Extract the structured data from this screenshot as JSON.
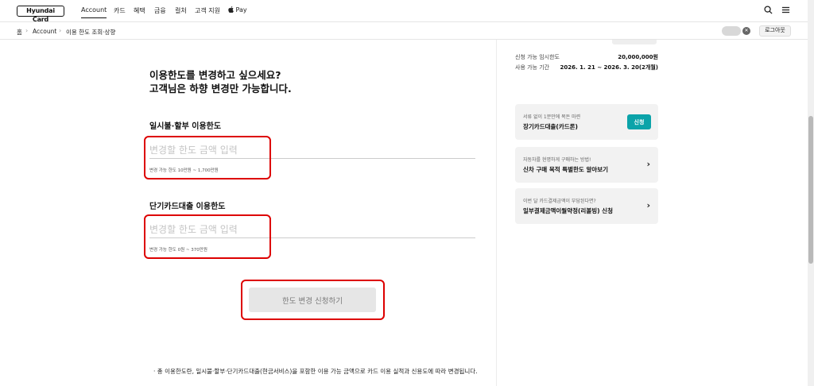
{
  "brand": {
    "logo_text": "Hyundai Card"
  },
  "nav": {
    "items": [
      {
        "label": "Account"
      },
      {
        "label": "카드"
      },
      {
        "label": "혜택"
      },
      {
        "label": "금융"
      },
      {
        "label": "컬처"
      },
      {
        "label": "고객 지원"
      },
      {
        "label": " Pay"
      }
    ],
    "active": "Account"
  },
  "icons": {
    "search": "search-icon",
    "menu": "hamburger-menu-icon",
    "apple": "apple-icon",
    "chevron": "chevron-right-icon"
  },
  "breadcrumb": {
    "home": "홈",
    "level1": "Account",
    "level2": "이용 한도 조회·상향"
  },
  "header_right": {
    "logout_label": "로그아웃"
  },
  "main": {
    "heading_line1": "이용한도를 변경하고 싶으세요?",
    "heading_line2": "고객님은 하향 변경만 가능합니다.",
    "lump_sum": {
      "label": "일시불·할부 이용한도",
      "placeholder": "변경할 한도 금액 입력",
      "hint": "변경 가능 한도 10만원 ~ 1,700만원"
    },
    "short_term_loan": {
      "label": "단기카드대출 이용한도",
      "placeholder": "변경할 한도 금액 입력",
      "hint": "변경 가능 한도 0원 ~ 370만원"
    },
    "submit_label": "한도 변경 신청하기",
    "footnote": "총 이용한도란, 일시불·할부·단기카드대출(현금서비스)을 포함한 이용 가능 금액으로 카드 이용 실적과 신용도에 따라 변경됩니다."
  },
  "side": {
    "rows": [
      {
        "label": "신청 가능 임시한도",
        "value": "20,000,000원"
      },
      {
        "label": "사용 가능 기간",
        "value": "2026. 1. 21 ~ 2026. 3. 20(2개월)"
      }
    ],
    "cards": [
      {
        "sub": "서류 없이 1분만에 목돈 마련",
        "title": "장기카드대출(카드론)",
        "button": "신청"
      },
      {
        "sub": "자동차를 현명하게 구매하는 방법!",
        "title": "신차 구매 목적 특별한도 알아보기"
      },
      {
        "sub": "이번 달 카드결제금액이 부담된다면?",
        "title": "일부결제금액이월약정(리볼빙) 신청"
      }
    ]
  },
  "colors": {
    "accent": "#0ba3a9",
    "highlight": "#dd0000",
    "button_disabled": "#e6e6e6"
  }
}
